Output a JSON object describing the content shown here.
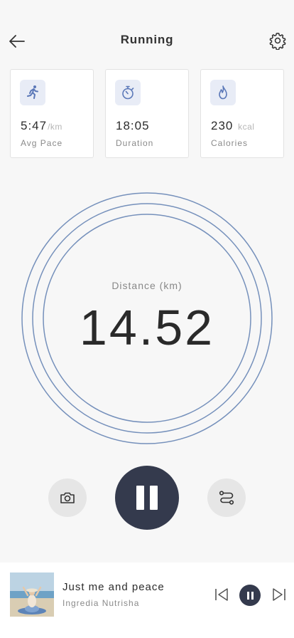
{
  "header": {
    "title": "Running"
  },
  "stats": [
    {
      "value": "5:47",
      "unit": "/km",
      "label": "Avg Pace",
      "icon": "running-person-icon"
    },
    {
      "value": "18:05",
      "unit": "",
      "label": "Duration",
      "icon": "stopwatch-icon"
    },
    {
      "value": "230",
      "unit": "kcal",
      "label": "Calories",
      "icon": "flame-icon"
    }
  ],
  "distance": {
    "label": "Distance (km)",
    "value": "14.52"
  },
  "controls": {
    "left_icon": "camera-icon",
    "center_icon": "pause-icon",
    "right_icon": "route-icon"
  },
  "player": {
    "title": "Just me and peace",
    "artist": "Ingredia Nutrisha"
  },
  "colors": {
    "accent": "#343a4d",
    "ring": "#7590bb",
    "icon_bg": "#e8ecf6",
    "icon_blue": "#5b78b8"
  }
}
